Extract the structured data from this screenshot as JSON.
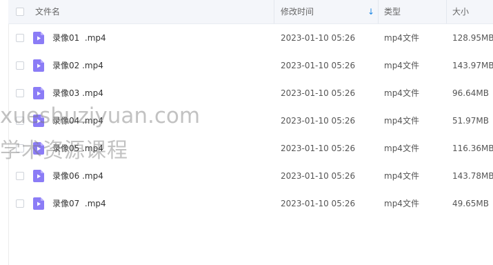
{
  "header": {
    "name": "文件名",
    "modified": "修改时间",
    "sort_arrow": "↓",
    "type": "类型",
    "size": "大小"
  },
  "files": [
    {
      "name": "录像01  .mp4",
      "modified": "2023-01-10 05:26",
      "type": "mp4文件",
      "size": "128.95MB"
    },
    {
      "name": "录像02 .mp4",
      "modified": "2023-01-10 05:26",
      "type": "mp4文件",
      "size": "143.97MB"
    },
    {
      "name": "录像03 .mp4",
      "modified": "2023-01-10 05:26",
      "type": "mp4文件",
      "size": "96.64MB"
    },
    {
      "name": "录像04 .mp4",
      "modified": "2023-01-10 05:26",
      "type": "mp4文件",
      "size": "51.97MB"
    },
    {
      "name": "录像05 .mp4",
      "modified": "2023-01-10 05:26",
      "type": "mp4文件",
      "size": "116.36MB"
    },
    {
      "name": "录像06 .mp4",
      "modified": "2023-01-10 05:26",
      "type": "mp4文件",
      "size": "143.78MB"
    },
    {
      "name": "录像07  .mp4",
      "modified": "2023-01-10 05:26",
      "type": "mp4文件",
      "size": "49.65MB"
    }
  ],
  "watermark": {
    "line1": "xueshuziyuan.com",
    "line2": "学术资源课程"
  },
  "colors": {
    "header_bg": "#f4f6fa",
    "file_icon": "#8b7cf6",
    "sort_arrow": "#1e88e5"
  }
}
